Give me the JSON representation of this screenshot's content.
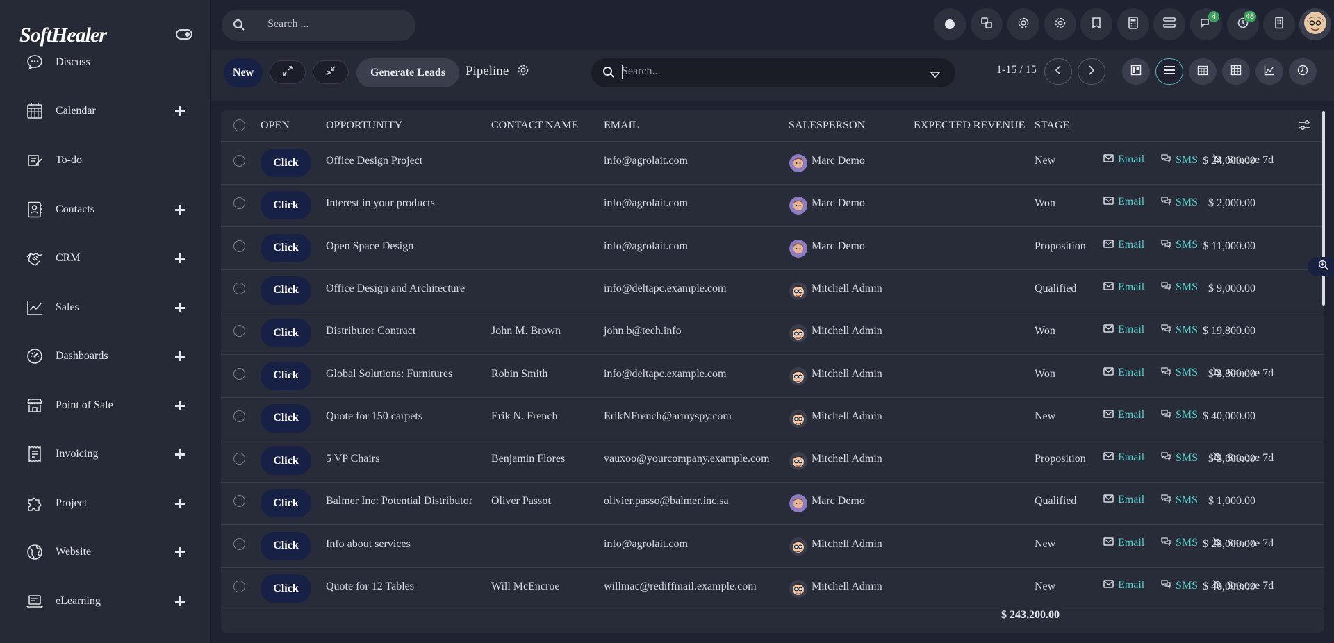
{
  "app": {
    "logo": "SoftHealer"
  },
  "sidebar": {
    "items": [
      {
        "label": "Discuss",
        "icon": "chat-bubble-icon",
        "has_add": false
      },
      {
        "label": "Calendar",
        "icon": "calendar-icon",
        "has_add": true
      },
      {
        "label": "To-do",
        "icon": "todo-icon",
        "has_add": false
      },
      {
        "label": "Contacts",
        "icon": "contacts-icon",
        "has_add": true
      },
      {
        "label": "CRM",
        "icon": "handshake-icon",
        "has_add": true
      },
      {
        "label": "Sales",
        "icon": "trend-chart-icon",
        "has_add": true
      },
      {
        "label": "Dashboards",
        "icon": "gauge-icon",
        "has_add": true
      },
      {
        "label": "Point of Sale",
        "icon": "store-icon",
        "has_add": true
      },
      {
        "label": "Invoicing",
        "icon": "receipt-icon",
        "has_add": true
      },
      {
        "label": "Project",
        "icon": "puzzle-icon",
        "has_add": true
      },
      {
        "label": "Website",
        "icon": "globe-icon",
        "has_add": true
      },
      {
        "label": "eLearning",
        "icon": "laptop-icon",
        "has_add": true
      }
    ]
  },
  "topbar": {
    "search_placeholder": "Search ...",
    "messages_badge": "4",
    "activities_badge": "48"
  },
  "control": {
    "new_label": "New",
    "generate_label": "Generate Leads",
    "breadcrumb": "Pipeline",
    "search_placeholder": "Search...",
    "pager": "1-15 / 15"
  },
  "table": {
    "headers": {
      "open": "OPEN",
      "opportunity": "OPPORTUNITY",
      "contact": "CONTACT NAME",
      "email": "EMAIL",
      "salesperson": "SALESPERSON",
      "revenue": "EXPECTED REVENUE",
      "stage": "STAGE"
    },
    "click_label": "Click",
    "email_label": "Email",
    "sms_label": "SMS",
    "snooze_label": "Snooze 7d",
    "rows": [
      {
        "opportunity": "Office Design Project",
        "contact": "",
        "email": "info@agrolait.com",
        "salesperson": "Marc Demo",
        "revenue": "$ 24,000.00",
        "stage": "New",
        "snooze": true
      },
      {
        "opportunity": "Interest in your products",
        "contact": "",
        "email": "info@agrolait.com",
        "salesperson": "Marc Demo",
        "revenue": "$ 2,000.00",
        "stage": "Won",
        "snooze": false
      },
      {
        "opportunity": "Open Space Design",
        "contact": "",
        "email": "info@agrolait.com",
        "salesperson": "Marc Demo",
        "revenue": "$ 11,000.00",
        "stage": "Proposition",
        "snooze": false
      },
      {
        "opportunity": "Office Design and Architecture",
        "contact": "",
        "email": "info@deltapc.example.com",
        "salesperson": "Mitchell Admin",
        "revenue": "$ 9,000.00",
        "stage": "Qualified",
        "snooze": false
      },
      {
        "opportunity": "Distributor Contract",
        "contact": "John M. Brown",
        "email": "john.b@tech.info",
        "salesperson": "Mitchell Admin",
        "revenue": "$ 19,800.00",
        "stage": "Won",
        "snooze": false
      },
      {
        "opportunity": "Global Solutions: Furnitures",
        "contact": "Robin Smith",
        "email": "info@deltapc.example.com",
        "salesperson": "Mitchell Admin",
        "revenue": "$ 3,800.00",
        "stage": "Won",
        "snooze": true
      },
      {
        "opportunity": "Quote for 150 carpets",
        "contact": "Erik N. French",
        "email": "ErikNFrench@armyspy.com",
        "salesperson": "Mitchell Admin",
        "revenue": "$ 40,000.00",
        "stage": "New",
        "snooze": false
      },
      {
        "opportunity": "5 VP Chairs",
        "contact": "Benjamin Flores",
        "email": "vauxoo@yourcompany.example.com",
        "salesperson": "Mitchell Admin",
        "revenue": "$ 5,600.00",
        "stage": "Proposition",
        "snooze": true
      },
      {
        "opportunity": "Balmer Inc: Potential Distributor",
        "contact": "Oliver Passot",
        "email": "olivier.passo@balmer.inc.sa",
        "salesperson": "Marc Demo",
        "revenue": "$ 1,000.00",
        "stage": "Qualified",
        "snooze": false
      },
      {
        "opportunity": "Info about services",
        "contact": "",
        "email": "info@agrolait.com",
        "salesperson": "Mitchell Admin",
        "revenue": "$ 25,000.00",
        "stage": "New",
        "snooze": true
      },
      {
        "opportunity": "Quote for 12 Tables",
        "contact": "Will McEncroe",
        "email": "willmac@rediffmail.example.com",
        "salesperson": "Mitchell Admin",
        "revenue": "$ 40,000.00",
        "stage": "New",
        "snooze": true
      }
    ],
    "total": "$ 243,200.00"
  },
  "colors": {
    "accent_teal": "#4fd1cc",
    "button_navy": "#172045",
    "badge_green": "#3aa05a"
  }
}
